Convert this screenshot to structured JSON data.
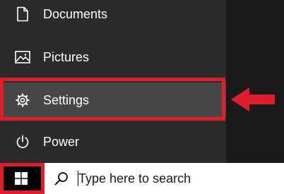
{
  "start_menu": {
    "items": [
      {
        "label": "Documents",
        "icon": "document-icon"
      },
      {
        "label": "Pictures",
        "icon": "pictures-icon"
      },
      {
        "label": "Settings",
        "icon": "gear-icon"
      },
      {
        "label": "Power",
        "icon": "power-icon"
      }
    ]
  },
  "taskbar": {
    "start_icon": "windows-logo-icon",
    "search_icon": "search-icon",
    "search_placeholder": "Type here to search"
  },
  "colors": {
    "highlight": "#e01e2b",
    "menu_background": "#2b2b2b",
    "selected_background": "#474747",
    "taskbar_background": "#101010",
    "search_background": "#ffffff"
  }
}
